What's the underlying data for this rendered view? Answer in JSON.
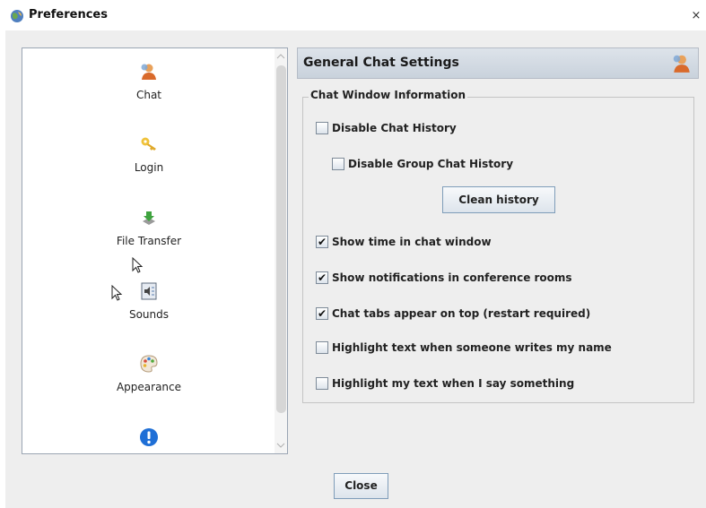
{
  "window": {
    "title": "Preferences",
    "close_glyph": "×",
    "title_icon": "preferences-globe-icon"
  },
  "nav": {
    "items": [
      {
        "label": "Chat",
        "icon": "chat-user-icon"
      },
      {
        "label": "Login",
        "icon": "key-icon"
      },
      {
        "label": "File Transfer",
        "icon": "file-transfer-icon"
      },
      {
        "label": "Sounds",
        "icon": "sounds-icon"
      },
      {
        "label": "Appearance",
        "icon": "palette-icon"
      },
      {
        "label": "",
        "icon": "info-alert-icon"
      }
    ]
  },
  "panel": {
    "header_title": "General Chat Settings",
    "group_title": "Chat Window Information",
    "options": [
      {
        "label": "Disable Chat History",
        "checked": false
      },
      {
        "label": "Disable Group Chat History",
        "checked": false
      },
      {
        "label": "Show time in chat window",
        "checked": true
      },
      {
        "label": "Show notifications in conference rooms",
        "checked": true
      },
      {
        "label": "Chat tabs appear on top (restart required)",
        "checked": true
      },
      {
        "label": "Highlight text when someone writes my name",
        "checked": false
      },
      {
        "label": "Highlight my text when I say something",
        "checked": false
      }
    ],
    "clean_button": "Clean history"
  },
  "footer": {
    "close_button": "Close"
  },
  "colors": {
    "content_bg": "#eeeeee",
    "header_gradient_top": "#dde3ea",
    "header_gradient_bottom": "#c9d2dc",
    "info_icon_blue": "#1f6fd6"
  },
  "check_glyph": "✔"
}
